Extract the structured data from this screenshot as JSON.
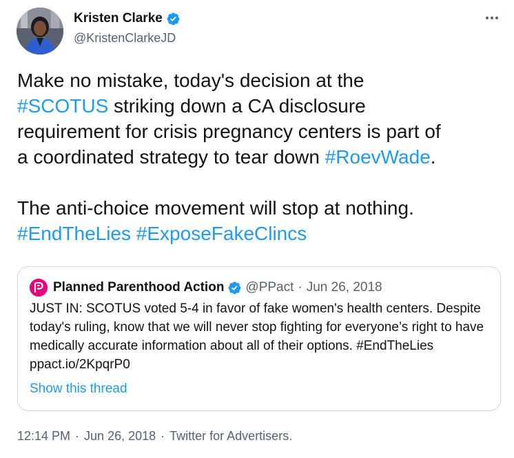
{
  "author": {
    "display_name": "Kristen Clarke",
    "handle": "@KristenClarkeJD"
  },
  "tweet": {
    "line1": "Make no mistake, today's decision at the",
    "tag_scotus": "#SCOTUS",
    "line2_rest": " striking down a CA disclosure",
    "line3": "requirement for crisis pregnancy centers is part of",
    "line4_start": "a coordinated strategy to tear down ",
    "tag_roe": "#RoevWade",
    "line4_end": ".",
    "line5": "The anti-choice movement will stop at nothing.",
    "tag_endthelies": "#EndTheLies",
    "tag_space": " ",
    "tag_expose": "#ExposeFakeClincs"
  },
  "quote": {
    "display_name": "Planned Parenthood Action",
    "handle": "@PPact",
    "separator": "·",
    "date": "Jun 26, 2018",
    "body": "JUST IN: SCOTUS voted 5-4 in favor of fake women's health centers. Despite today's ruling, know that we will never stop fighting for everyone’s right to have medically accurate information about all of their options. #EndTheLies ppact.io/2KpqrP0",
    "show_thread": "Show this thread"
  },
  "meta": {
    "time": "12:14 PM",
    "sep1": "·",
    "date": "Jun 26, 2018",
    "sep2": "·",
    "source": "Twitter for Advertisers."
  },
  "colors": {
    "link": "#1d9bf0",
    "secondary": "#536471",
    "verified": "#1d9bf0",
    "border": "#cfd9de"
  },
  "icons": {
    "verified": "verified-badge-icon",
    "more": "more-options-icon"
  }
}
